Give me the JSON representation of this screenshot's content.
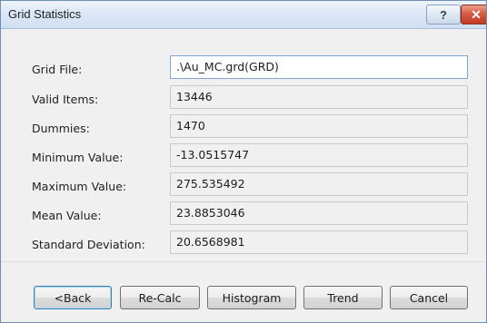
{
  "window": {
    "title": "Grid Statistics"
  },
  "titlebar_buttons": {
    "help": "?",
    "close": "✕"
  },
  "fields": [
    {
      "label": "Grid File:",
      "value": ".\\Au_MC.grd(GRD)"
    },
    {
      "label": "Valid Items:",
      "value": "13446"
    },
    {
      "label": "Dummies:",
      "value": "1470"
    },
    {
      "label": "Minimum Value:",
      "value": "-13.0515747"
    },
    {
      "label": "Maximum Value:",
      "value": "275.535492"
    },
    {
      "label": "Mean Value:",
      "value": "23.8853046"
    },
    {
      "label": "Standard Deviation:",
      "value": "20.6568981"
    }
  ],
  "buttons": {
    "back": "<Back",
    "recalc": "Re-Calc",
    "histogram": "Histogram",
    "trend": "Trend",
    "cancel": "Cancel"
  }
}
